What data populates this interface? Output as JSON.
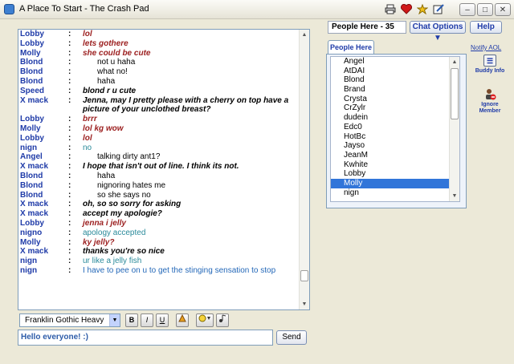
{
  "window": {
    "title": "A Place To Start - The Crash Pad",
    "toolbar_icons": [
      "printer-icon",
      "heart-icon",
      "stars-icon",
      "edit-note-icon"
    ],
    "buttons": [
      "minimize",
      "maximize",
      "close"
    ]
  },
  "header": {
    "people_count": "People Here - 35",
    "chat_options": "Chat Options",
    "help": "Help"
  },
  "people": {
    "tab_label": "People Here",
    "notify_label": "Notify AOL",
    "buddy_info_label": "Buddy Info",
    "ignore_member_label": "Ignore Member",
    "selected": "Molly",
    "list": [
      "Angel",
      "AtDAI",
      "Blond",
      "Brand",
      "Crysta",
      "CrZylr",
      "dudein",
      "Edc0",
      "HotBc",
      "Jayso",
      "JeanM",
      "Kwhite",
      "Lobby",
      "Molly",
      "nign"
    ]
  },
  "chat": {
    "colon": ":",
    "messages": [
      {
        "name": "Lobby",
        "text": "lol",
        "style": "red"
      },
      {
        "name": "Lobby",
        "text": "lets gothere",
        "style": "red"
      },
      {
        "name": "Molly",
        "text": "she could be cute",
        "style": "red"
      },
      {
        "name": "Blond",
        "text": "not u haha",
        "style": "plain"
      },
      {
        "name": "Blond",
        "text": "what no!",
        "style": "plain"
      },
      {
        "name": "Blond",
        "text": "haha",
        "style": "plain"
      },
      {
        "name": "Speed",
        "text": "blond r u cute",
        "style": "bi"
      },
      {
        "name": "X mack",
        "text": "Jenna, may I pretty please with a cherry on top have a picture of your unclothed breast?",
        "style": "bi",
        "tall": true
      },
      {
        "name": "Lobby",
        "text": "brrr",
        "style": "red"
      },
      {
        "name": "Molly",
        "text": "lol kg wow",
        "style": "red"
      },
      {
        "name": "Lobby",
        "text": "lol",
        "style": "red"
      },
      {
        "name": "nign",
        "text": "no",
        "style": "teal"
      },
      {
        "name": "Angel",
        "text": "talking dirty ant1?",
        "style": "plain"
      },
      {
        "name": "X mack",
        "text": "I hope that isn't out of line.  I think its not.",
        "style": "bi"
      },
      {
        "name": "Blond",
        "text": "haha",
        "style": "plain"
      },
      {
        "name": "Blond",
        "text": "nignoring hates me",
        "style": "plain"
      },
      {
        "name": "Blond",
        "text": "so she says no",
        "style": "plain"
      },
      {
        "name": "X mack",
        "text": "oh, so so sorry for asking",
        "style": "bi"
      },
      {
        "name": "X mack",
        "text": "accept my apologie?",
        "style": "bi"
      },
      {
        "name": "Lobby",
        "text": "jenna i jelly",
        "style": "red"
      },
      {
        "name": "nigno",
        "text": "apology accepted",
        "style": "teal"
      },
      {
        "name": "Molly",
        "text": "ky jelly?",
        "style": "red"
      },
      {
        "name": "X mack",
        "text": "thanks you're so nice",
        "style": "bi"
      },
      {
        "name": "nign",
        "text": "ur like a jelly fish",
        "style": "teal"
      },
      {
        "name": "nign",
        "text": "I have to pee on u to get the stinging sensation to stop",
        "style": "blue"
      }
    ]
  },
  "compose": {
    "font": "Franklin Gothic Heavy",
    "format_buttons": [
      "B",
      "I",
      "U"
    ],
    "input_value": "Hello everyone! :)",
    "send_label": "Send"
  }
}
